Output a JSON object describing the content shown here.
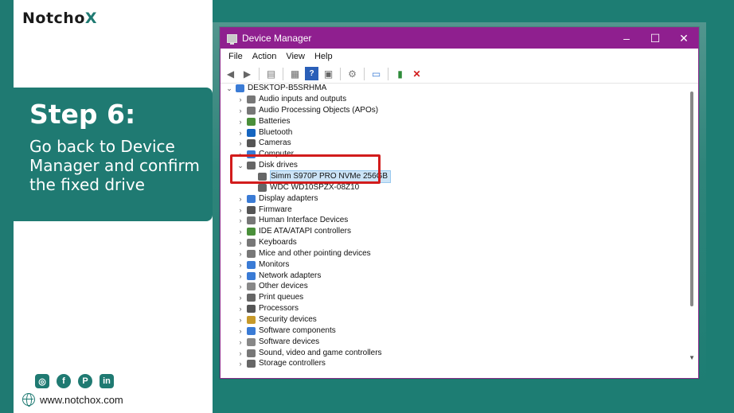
{
  "brand": {
    "logo_main": "Notcho",
    "logo_x": "X"
  },
  "step": {
    "title": "Step 6:",
    "description": "Go back to Device Manager and confirm the fixed drive"
  },
  "socials": [
    "instagram-icon",
    "facebook-icon",
    "pinterest-icon",
    "linkedin-icon"
  ],
  "website": "www.notchox.com",
  "window": {
    "title": "Device Manager",
    "controls": {
      "minimize": "–",
      "maximize": "☐",
      "close": "✕"
    },
    "menu": [
      "File",
      "Action",
      "View",
      "Help"
    ],
    "tree": {
      "root": "DESKTOP-B5SRHMA",
      "items": [
        {
          "label": "Audio inputs and outputs",
          "icon": "speaker-icon",
          "color": "#777777"
        },
        {
          "label": "Audio Processing Objects (APOs)",
          "icon": "speaker-icon",
          "color": "#777777"
        },
        {
          "label": "Batteries",
          "icon": "battery-icon",
          "color": "#4a8f3a"
        },
        {
          "label": "Bluetooth",
          "icon": "bluetooth-icon",
          "color": "#1565c0"
        },
        {
          "label": "Cameras",
          "icon": "camera-icon",
          "color": "#555555"
        },
        {
          "label": "Computer",
          "icon": "computer-icon",
          "color": "#3a7bd5"
        },
        {
          "label": "Disk drives",
          "icon": "disk-icon",
          "color": "#666666",
          "expanded": true
        },
        {
          "label": "Simm S970P PRO NVMe 256GB",
          "icon": "disk-icon",
          "color": "#666666",
          "child": true,
          "selected": true
        },
        {
          "label": "WDC WD10SPZX-08Z10",
          "icon": "disk-icon",
          "color": "#666666",
          "child": true
        },
        {
          "label": "Display adapters",
          "icon": "display-icon",
          "color": "#3a7bd5"
        },
        {
          "label": "Firmware",
          "icon": "chip-icon",
          "color": "#555555"
        },
        {
          "label": "Human Interface Devices",
          "icon": "hid-icon",
          "color": "#777777"
        },
        {
          "label": "IDE ATA/ATAPI controllers",
          "icon": "controller-icon",
          "color": "#4a8f3a"
        },
        {
          "label": "Keyboards",
          "icon": "keyboard-icon",
          "color": "#777777"
        },
        {
          "label": "Mice and other pointing devices",
          "icon": "mouse-icon",
          "color": "#777777"
        },
        {
          "label": "Monitors",
          "icon": "monitor-icon",
          "color": "#3a7bd5"
        },
        {
          "label": "Network adapters",
          "icon": "network-icon",
          "color": "#3a7bd5"
        },
        {
          "label": "Other devices",
          "icon": "unknown-device-icon",
          "color": "#888888"
        },
        {
          "label": "Print queues",
          "icon": "printer-icon",
          "color": "#666666"
        },
        {
          "label": "Processors",
          "icon": "cpu-icon",
          "color": "#555555"
        },
        {
          "label": "Security devices",
          "icon": "security-icon",
          "color": "#c79a2a"
        },
        {
          "label": "Software components",
          "icon": "puzzle-icon",
          "color": "#3a7bd5"
        },
        {
          "label": "Software devices",
          "icon": "software-icon",
          "color": "#888888"
        },
        {
          "label": "Sound, video and game controllers",
          "icon": "speaker-icon",
          "color": "#777777"
        },
        {
          "label": "Storage controllers",
          "icon": "storage-icon",
          "color": "#666666"
        }
      ]
    }
  }
}
